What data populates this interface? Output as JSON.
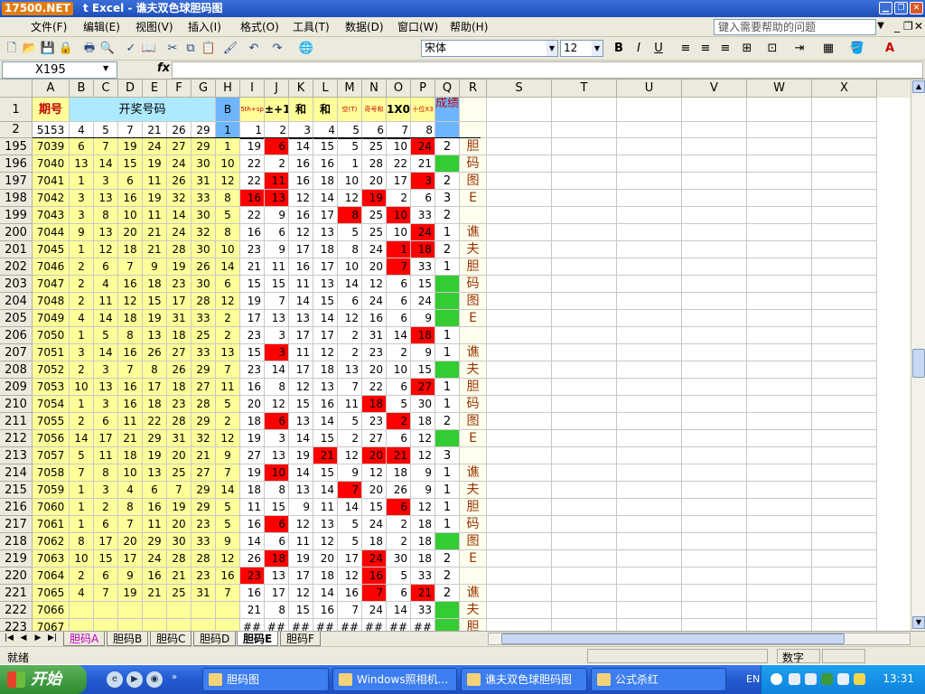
{
  "window": {
    "logo": "17500.NET",
    "title": "t Excel - 谯夫双色球胆码图"
  },
  "menu": {
    "items": [
      "文件(F)",
      "编辑(E)",
      "视图(V)",
      "插入(I)",
      "格式(O)",
      "工具(T)",
      "数据(D)",
      "窗口(W)",
      "帮助(H)"
    ],
    "help_placeholder": "键入需要帮助的问题"
  },
  "toolbar": {
    "font": "宋体",
    "size": "12"
  },
  "formula": {
    "name_box": "X195",
    "fx": "fx",
    "content": ""
  },
  "colors": {
    "yellow": "#ffff99",
    "cyan": "#aeeaff",
    "blue": "#6db5ff",
    "red": "#ff0000",
    "green": "#33cc33",
    "darkred": "#993300"
  },
  "columns": [
    "A",
    "B",
    "C",
    "D",
    "E",
    "F",
    "G",
    "H",
    "I",
    "J",
    "K",
    "L",
    "M",
    "N",
    "O",
    "P",
    "Q",
    "R",
    "S",
    "T",
    "U",
    "V",
    "W",
    "X"
  ],
  "header_row1": {
    "row": "1",
    "A": "期号",
    "BG": "开奖号码",
    "H": "B",
    "I": "5th+sp",
    "J": "±+1",
    "K": "和",
    "L": "和",
    "M": "空(T)",
    "N": "奇号和",
    "O": "1X0+2",
    "P": "十位X3",
    "Q": "成绩"
  },
  "header_row2": {
    "row": "2",
    "A": "5153",
    "nums": [
      "4",
      "5",
      "7",
      "21",
      "26",
      "29"
    ],
    "H": "1",
    "idx": [
      "1",
      "2",
      "3",
      "4",
      "5",
      "6",
      "7",
      "8"
    ]
  },
  "rows": [
    {
      "r": "195",
      "p": "7039",
      "n": [
        "6",
        "7",
        "19",
        "24",
        "27",
        "29"
      ],
      "h": "1",
      "v": [
        "19",
        "6",
        "14",
        "15",
        "5",
        "25",
        "10",
        "24"
      ],
      "red": [
        1,
        7
      ],
      "q": "2",
      "R": "胆"
    },
    {
      "r": "196",
      "p": "7040",
      "n": [
        "13",
        "14",
        "15",
        "19",
        "24",
        "30"
      ],
      "h": "10",
      "v": [
        "22",
        "2",
        "16",
        "16",
        "1",
        "28",
        "22",
        "21"
      ],
      "red": [],
      "q": "",
      "R": "码"
    },
    {
      "r": "197",
      "p": "7041",
      "n": [
        "1",
        "3",
        "6",
        "11",
        "26",
        "31"
      ],
      "h": "12",
      "v": [
        "22",
        "11",
        "16",
        "18",
        "10",
        "20",
        "17",
        "3"
      ],
      "red": [
        1,
        7
      ],
      "q": "2",
      "R": "图"
    },
    {
      "r": "198",
      "p": "7042",
      "n": [
        "3",
        "13",
        "16",
        "19",
        "32",
        "33"
      ],
      "h": "8",
      "v": [
        "16",
        "13",
        "12",
        "14",
        "12",
        "19",
        "2",
        "6"
      ],
      "red": [
        0,
        1,
        5
      ],
      "q": "3",
      "R": "E"
    },
    {
      "r": "199",
      "p": "7043",
      "n": [
        "3",
        "8",
        "10",
        "11",
        "14",
        "30"
      ],
      "h": "5",
      "v": [
        "22",
        "9",
        "16",
        "17",
        "8",
        "25",
        "10",
        "33"
      ],
      "red": [
        4,
        6
      ],
      "q": "2",
      "R": ""
    },
    {
      "r": "200",
      "p": "7044",
      "n": [
        "9",
        "13",
        "20",
        "21",
        "24",
        "32"
      ],
      "h": "8",
      "v": [
        "16",
        "6",
        "12",
        "13",
        "5",
        "25",
        "10",
        "24"
      ],
      "red": [
        7
      ],
      "q": "1",
      "R": "谯"
    },
    {
      "r": "201",
      "p": "7045",
      "n": [
        "1",
        "12",
        "18",
        "21",
        "28",
        "30"
      ],
      "h": "10",
      "v": [
        "23",
        "9",
        "17",
        "18",
        "8",
        "24",
        "1",
        "18"
      ],
      "red": [
        6,
        7
      ],
      "q": "2",
      "R": "夫"
    },
    {
      "r": "202",
      "p": "7046",
      "n": [
        "2",
        "6",
        "7",
        "9",
        "19",
        "26"
      ],
      "h": "14",
      "v": [
        "21",
        "11",
        "16",
        "17",
        "10",
        "20",
        "7",
        "33"
      ],
      "red": [
        6
      ],
      "q": "1",
      "R": "胆"
    },
    {
      "r": "203",
      "p": "7047",
      "n": [
        "2",
        "4",
        "16",
        "18",
        "23",
        "30"
      ],
      "h": "6",
      "v": [
        "15",
        "15",
        "11",
        "13",
        "14",
        "12",
        "6",
        "15"
      ],
      "red": [],
      "q": "",
      "R": "码"
    },
    {
      "r": "204",
      "p": "7048",
      "n": [
        "2",
        "11",
        "12",
        "15",
        "17",
        "28"
      ],
      "h": "12",
      "v": [
        "19",
        "7",
        "14",
        "15",
        "6",
        "24",
        "6",
        "24"
      ],
      "red": [],
      "q": "",
      "R": "图"
    },
    {
      "r": "205",
      "p": "7049",
      "n": [
        "4",
        "14",
        "18",
        "19",
        "31",
        "33"
      ],
      "h": "2",
      "v": [
        "17",
        "13",
        "13",
        "14",
        "12",
        "16",
        "6",
        "9"
      ],
      "red": [],
      "q": "",
      "R": "E"
    },
    {
      "r": "206",
      "p": "7050",
      "n": [
        "1",
        "5",
        "8",
        "13",
        "18",
        "25"
      ],
      "h": "2",
      "v": [
        "23",
        "3",
        "17",
        "17",
        "2",
        "31",
        "14",
        "18"
      ],
      "red": [
        7
      ],
      "q": "1",
      "R": ""
    },
    {
      "r": "207",
      "p": "7051",
      "n": [
        "3",
        "14",
        "16",
        "26",
        "27",
        "33"
      ],
      "h": "13",
      "v": [
        "15",
        "3",
        "11",
        "12",
        "2",
        "23",
        "2",
        "9"
      ],
      "red": [
        1
      ],
      "q": "1",
      "R": "谯"
    },
    {
      "r": "208",
      "p": "7052",
      "n": [
        "2",
        "3",
        "7",
        "8",
        "26",
        "29"
      ],
      "h": "7",
      "v": [
        "23",
        "14",
        "17",
        "18",
        "13",
        "20",
        "10",
        "15"
      ],
      "red": [],
      "q": "",
      "R": "夫"
    },
    {
      "r": "209",
      "p": "7053",
      "n": [
        "10",
        "13",
        "16",
        "17",
        "18",
        "27"
      ],
      "h": "11",
      "v": [
        "16",
        "8",
        "12",
        "13",
        "7",
        "22",
        "6",
        "27"
      ],
      "red": [
        7
      ],
      "q": "1",
      "R": "胆"
    },
    {
      "r": "210",
      "p": "7054",
      "n": [
        "1",
        "3",
        "16",
        "18",
        "23",
        "28"
      ],
      "h": "5",
      "v": [
        "20",
        "12",
        "15",
        "16",
        "11",
        "18",
        "5",
        "30"
      ],
      "red": [
        5
      ],
      "q": "1",
      "R": "码"
    },
    {
      "r": "211",
      "p": "7055",
      "n": [
        "2",
        "6",
        "11",
        "22",
        "28",
        "29"
      ],
      "h": "2",
      "v": [
        "18",
        "6",
        "13",
        "14",
        "5",
        "23",
        "2",
        "18"
      ],
      "red": [
        1,
        6
      ],
      "q": "2",
      "R": "图"
    },
    {
      "r": "212",
      "p": "7056",
      "n": [
        "14",
        "17",
        "21",
        "29",
        "31",
        "32"
      ],
      "h": "12",
      "v": [
        "19",
        "3",
        "14",
        "15",
        "2",
        "27",
        "6",
        "12"
      ],
      "red": [],
      "q": "",
      "R": "E"
    },
    {
      "r": "213",
      "p": "7057",
      "n": [
        "5",
        "11",
        "18",
        "19",
        "20",
        "21"
      ],
      "h": "9",
      "v": [
        "27",
        "13",
        "19",
        "21",
        "12",
        "20",
        "21",
        "12"
      ],
      "red": [
        3,
        5,
        6
      ],
      "q": "3",
      "R": ""
    },
    {
      "r": "214",
      "p": "7058",
      "n": [
        "7",
        "8",
        "10",
        "13",
        "25",
        "27"
      ],
      "h": "7",
      "v": [
        "19",
        "10",
        "14",
        "15",
        "9",
        "12",
        "18",
        "9"
      ],
      "red": [
        1
      ],
      "q": "1",
      "R": "谯"
    },
    {
      "r": "215",
      "p": "7059",
      "n": [
        "1",
        "3",
        "4",
        "6",
        "7",
        "29"
      ],
      "h": "14",
      "v": [
        "18",
        "8",
        "13",
        "14",
        "7",
        "20",
        "26",
        "9"
      ],
      "red": [
        4
      ],
      "q": "1",
      "R": "夫"
    },
    {
      "r": "216",
      "p": "7060",
      "n": [
        "1",
        "2",
        "8",
        "16",
        "19",
        "29"
      ],
      "h": "5",
      "v": [
        "11",
        "15",
        "9",
        "11",
        "14",
        "15",
        "6",
        "12"
      ],
      "red": [
        6
      ],
      "q": "1",
      "R": "胆"
    },
    {
      "r": "217",
      "p": "7061",
      "n": [
        "1",
        "6",
        "7",
        "11",
        "20",
        "23"
      ],
      "h": "5",
      "v": [
        "16",
        "6",
        "12",
        "13",
        "5",
        "24",
        "2",
        "18"
      ],
      "red": [
        1
      ],
      "q": "1",
      "R": "码"
    },
    {
      "r": "218",
      "p": "7062",
      "n": [
        "8",
        "17",
        "20",
        "29",
        "30",
        "33"
      ],
      "h": "9",
      "v": [
        "14",
        "6",
        "11",
        "12",
        "5",
        "18",
        "2",
        "18"
      ],
      "red": [],
      "q": "",
      "R": "图"
    },
    {
      "r": "219",
      "p": "7063",
      "n": [
        "10",
        "15",
        "17",
        "24",
        "28",
        "28"
      ],
      "h": "12",
      "v": [
        "26",
        "18",
        "19",
        "20",
        "17",
        "24",
        "30",
        "18"
      ],
      "red": [
        1,
        5
      ],
      "q": "2",
      "R": "E"
    },
    {
      "r": "220",
      "p": "7064",
      "n": [
        "2",
        "6",
        "9",
        "16",
        "21",
        "23"
      ],
      "h": "16",
      "v": [
        "23",
        "13",
        "17",
        "18",
        "12",
        "16",
        "5",
        "33"
      ],
      "red": [
        0,
        5
      ],
      "q": "2",
      "R": ""
    },
    {
      "r": "221",
      "p": "7065",
      "n": [
        "4",
        "7",
        "19",
        "21",
        "25",
        "31"
      ],
      "h": "7",
      "v": [
        "16",
        "17",
        "12",
        "14",
        "16",
        "7",
        "6",
        "21"
      ],
      "red": [
        5,
        7
      ],
      "q": "2",
      "R": "谯"
    },
    {
      "r": "222",
      "p": "7066",
      "n": [
        "",
        "",
        "",
        "",
        "",
        ""
      ],
      "h": "",
      "v": [
        "21",
        "8",
        "15",
        "16",
        "7",
        "24",
        "14",
        "33"
      ],
      "red": [],
      "q": "",
      "R": "夫"
    },
    {
      "r": "223",
      "p": "7067",
      "n": [
        "",
        "",
        "",
        "",
        "",
        ""
      ],
      "h": "",
      "v": [
        "##",
        "##",
        "##",
        "##",
        "##",
        "##",
        "##",
        "##"
      ],
      "red": [],
      "q": "",
      "R": "胆"
    }
  ],
  "sheets": {
    "tabs": [
      "胆码A",
      "胆码B",
      "胆码C",
      "胆码D",
      "胆码E",
      "胆码F"
    ],
    "active": "胆码E"
  },
  "status": {
    "left": "就绪",
    "mode": "数字"
  },
  "taskbar": {
    "start": "开始",
    "tasks": [
      "胆码图",
      "Windows照相机...",
      "谯夫双色球胆码图",
      "公式杀红"
    ],
    "lang": "EN",
    "clock": "13:31"
  }
}
